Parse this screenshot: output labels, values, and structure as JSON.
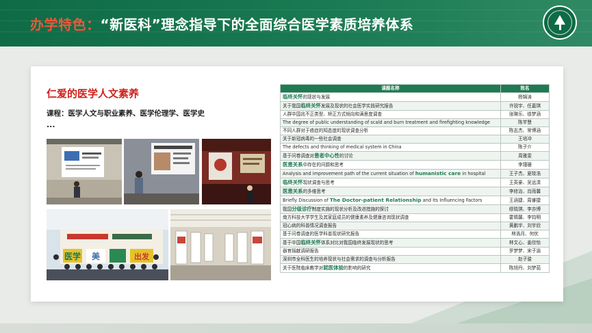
{
  "header": {
    "title_prefix": "办学特色：",
    "title_main": "“新医科”理念指导下的全面综合医学素质培养体系",
    "logo_icon": "university-seal-icon"
  },
  "section": {
    "title": "仁爱的医学人文素养",
    "course_line": "课程：医学人文与职业素养、医学伦理学、医学史",
    "ellipsis": "..."
  },
  "photos": {
    "banner_text_1": "医学",
    "banner_text_2": "美",
    "banner_text_3": "出发"
  },
  "table": {
    "header": {
      "course": "课题名称",
      "name": "姓名"
    },
    "rows": [
      {
        "pre": "",
        "hl": "临终关怀",
        "post": "的现状与发展",
        "name": "杨锦涛"
      },
      {
        "pre": "关于我国",
        "hl": "临终关怀",
        "post": "发展及现状的社会医学实践研究报告",
        "name": "许锐宇、任嘉琪"
      },
      {
        "pre": "人群中国兆不正类型、矫正方式倾向和满意度调查",
        "hl": "",
        "post": "",
        "name": "张琳乐、徐梦涵"
      },
      {
        "pre": "The degree of public understanding of scald and burn treatment and firefighting knowledge",
        "hl": "",
        "post": "",
        "name": "陈芊慧"
      },
      {
        "pre": "不同人群对于癌症的知态度的现状调查分析",
        "hl": "",
        "post": "",
        "name": "陈志杰、常博涵"
      },
      {
        "pre": "关于新冠病毒的一些社会调查",
        "hl": "",
        "post": "",
        "name": "王培冲"
      },
      {
        "pre": "The defects and thinking of medical system in China",
        "hl": "",
        "post": "",
        "name": "陈子介"
      },
      {
        "pre": "基于问卷调查对",
        "hl": "患者中心性",
        "post": "的讨论",
        "name": "周雅雯"
      },
      {
        "pre": "",
        "hl": "医患关系",
        "post": "中存在的问题和思考",
        "name": "李瑾珊"
      },
      {
        "pre": "Analysis and improvement path of the current situation of ",
        "hl": "humanistic care",
        "post": " in hospital",
        "name": "王子杰、夏晓浩"
      },
      {
        "pre": "",
        "hl": "临终关怀",
        "post": "现状调查与思考",
        "name": "王英豪、吴远清"
      },
      {
        "pre": "",
        "hl": "医患关系",
        "post": "的多维思考",
        "name": "李修治、肖雨馨"
      },
      {
        "pre": "Briefly Discussion of ",
        "hl": "The Doctor-patient Relationship",
        "post": " and Its Influencing Factors",
        "name": "王涵捷、周睿捷"
      },
      {
        "pre": "我国",
        "hl": "分级诊疗",
        "post": "制度实施的现状分析及改进措施的探讨",
        "name": "缪晓琪、李亦博"
      },
      {
        "pre": "南方科技大学学生及其家庭成员的健康素养及健康咨询现状调查",
        "hl": "",
        "post": "",
        "name": "霍晴馨、李钧明"
      },
      {
        "pre": "冠心病的科普情况调查报告",
        "hl": "",
        "post": "",
        "name": "黄鹏宇、刘宇欣"
      },
      {
        "pre": "基于问卷调查的医学科普现状研究报告",
        "hl": "",
        "post": "",
        "name": "林浩月、何优"
      },
      {
        "pre": "基于中国",
        "hl": "临终关怀",
        "post": "体系对比对我国临终发展现状的思考",
        "name": "林文心、姜欣怡"
      },
      {
        "pre": "器官捐献调研报告",
        "hl": "",
        "post": "",
        "name": "罗梦梦、宋子渝"
      },
      {
        "pre": "深圳市全科医生的培养现状与社会需求的调查与分析报告",
        "hl": "",
        "post": "",
        "name": "赵子骏"
      },
      {
        "pre": "关于医院临床教学对",
        "hl": "就医体验",
        "post": "的影响的研究",
        "name": "陈旭丹、刘梦茹"
      }
    ]
  }
}
